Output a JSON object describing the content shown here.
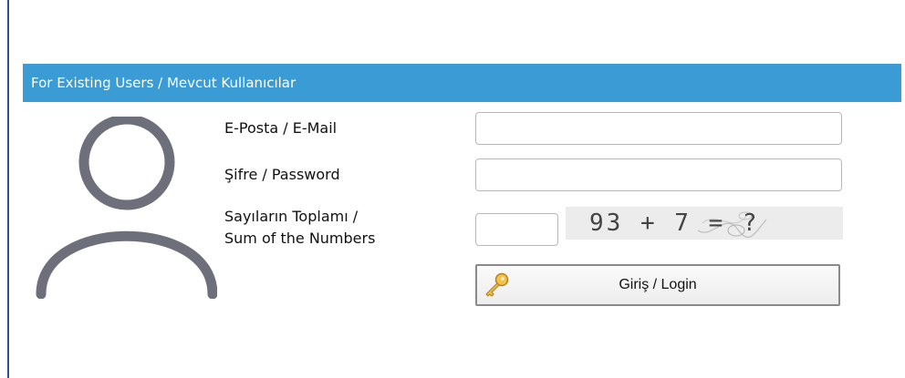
{
  "section": {
    "title": "For Existing Users / Mevcut Kullanıcılar"
  },
  "form": {
    "email_label": "E-Posta / E-Mail",
    "email_value": "",
    "password_label": "Şifre / Password",
    "password_value": "",
    "captcha_label_line1": "Sayıların Toplamı /",
    "captcha_label_line2": "Sum of the Numbers",
    "captcha_value": "",
    "captcha_text": "93 + 7 = ?",
    "login_label": "Giriş / Login"
  },
  "icons": {
    "avatar": "user-avatar-icon",
    "key": "key-icon"
  },
  "colors": {
    "header_bg": "#3a9bd5",
    "avatar_stroke": "#6d6f7b",
    "left_rule": "#2f4f8f"
  }
}
